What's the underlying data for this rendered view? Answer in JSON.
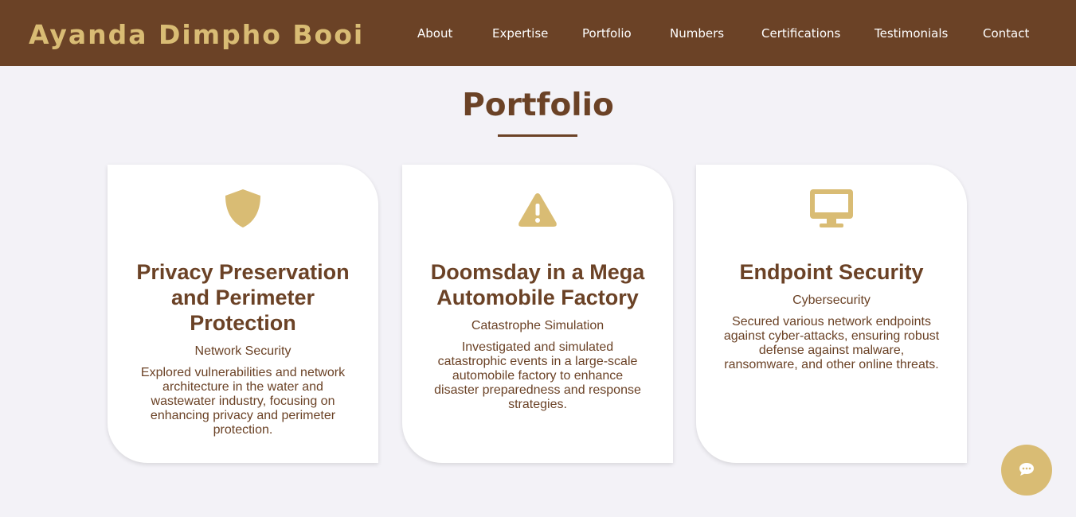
{
  "brand": "Ayanda Dimpho Booi",
  "nav": [
    "About",
    "Expertise",
    "Portfolio",
    "Numbers",
    "Certifications",
    "Testimonials",
    "Contact"
  ],
  "section": {
    "title": "Portfolio"
  },
  "cards": [
    {
      "icon": "shield-icon",
      "title": "Privacy Preservation and Perimeter Protection",
      "subtitle": "Network Security",
      "description": "Explored vulnerabilities and network architecture in the water and wastewater industry, focusing on enhancing privacy and perimeter protection."
    },
    {
      "icon": "warning-icon",
      "title": "Doomsday in a Mega Automobile Factory",
      "subtitle": "Catastrophe Simulation",
      "description": "Investigated and simulated catastrophic events in a large-scale automobile factory to enhance disaster preparedness and response strategies."
    },
    {
      "icon": "desktop-icon",
      "title": "Endpoint Security",
      "subtitle": "Cybersecurity",
      "description": "Secured various network endpoints against cyber-attacks, ensuring robust defense against malware, ransomware, and other online threats."
    }
  ],
  "chat": {
    "icon": "chat-icon"
  },
  "colors": {
    "primary": "#6b4226",
    "accent": "#d9bc74",
    "background": "#f3f2f7",
    "card": "#ffffff"
  }
}
